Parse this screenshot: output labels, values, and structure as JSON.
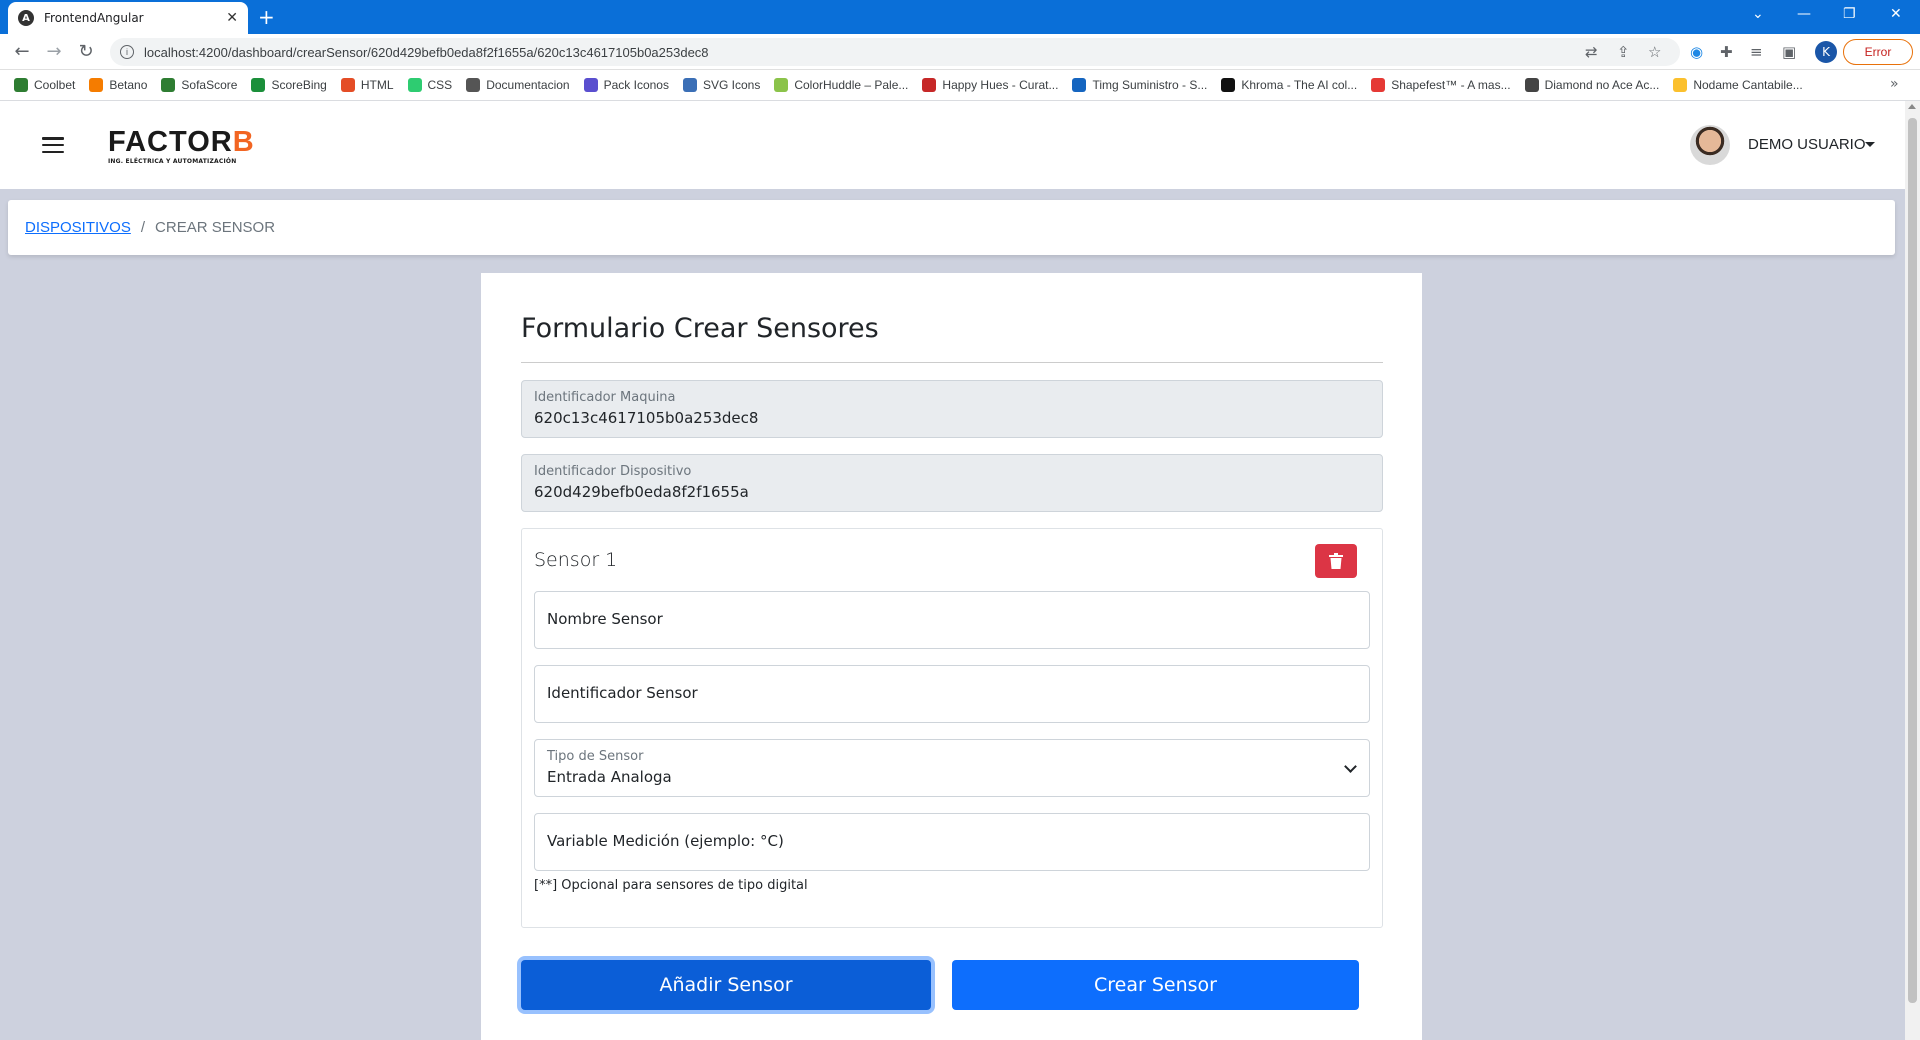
{
  "browser": {
    "tab_title": "FrontendAngular",
    "tab_icon_letter": "A",
    "url": "localhost:4200/dashboard/crearSensor/620d429befb0eda8f2f1655a/620c13c4617105b0a253dec8",
    "profile_letter": "K",
    "error_label": "Error",
    "bookmarks": [
      {
        "label": "Coolbet",
        "color": "#2e7d32"
      },
      {
        "label": "Betano",
        "color": "#f57c00"
      },
      {
        "label": "SofaScore",
        "color": "#2e7d32"
      },
      {
        "label": "ScoreBing",
        "color": "#1b8f3a"
      },
      {
        "label": "HTML",
        "color": "#e44d26"
      },
      {
        "label": "CSS",
        "color": "#2ecc71"
      },
      {
        "label": "Documentacion",
        "color": "#555555"
      },
      {
        "label": "Pack Iconos",
        "color": "#5a4fcf"
      },
      {
        "label": "SVG Icons",
        "color": "#3b6fb6"
      },
      {
        "label": "ColorHuddle – Pale...",
        "color": "#8bc34a"
      },
      {
        "label": "Happy Hues - Curat...",
        "color": "#c62828"
      },
      {
        "label": "Timg Suministro - S...",
        "color": "#1565c0"
      },
      {
        "label": "Khroma - The AI col...",
        "color": "#111111"
      },
      {
        "label": "Shapefest™ - A mas...",
        "color": "#e53935"
      },
      {
        "label": "Diamond no Ace Ac...",
        "color": "#444444"
      },
      {
        "label": "Nodame Cantabile...",
        "color": "#fbc02d"
      }
    ]
  },
  "header": {
    "logo_main": "FACTOR",
    "logo_accent": "B",
    "logo_sub": "ING. ELÉCTRICA Y AUTOMATIZACIÓN",
    "user_name": "DEMO USUARIO"
  },
  "breadcrumb": {
    "parent": "DISPOSITIVOS",
    "separator": "/",
    "current": "CREAR SENSOR"
  },
  "form": {
    "title": "Formulario Crear Sensores",
    "machine_id_label": "Identificador Maquina",
    "machine_id_value": "620c13c4617105b0a253dec8",
    "device_id_label": "Identificador Dispositivo",
    "device_id_value": "620d429befb0eda8f2f1655a",
    "sensor": {
      "title": "Sensor 1",
      "name_placeholder": "Nombre Sensor",
      "id_placeholder": "Identificador Sensor",
      "type_label": "Tipo de Sensor",
      "type_value": "Entrada Analoga",
      "variable_placeholder": "Variable Medición (ejemplo: °C)",
      "hint": "[**] Opcional para sensores de tipo digital"
    },
    "add_button": "Añadir Sensor",
    "create_button": "Crear Sensor"
  }
}
